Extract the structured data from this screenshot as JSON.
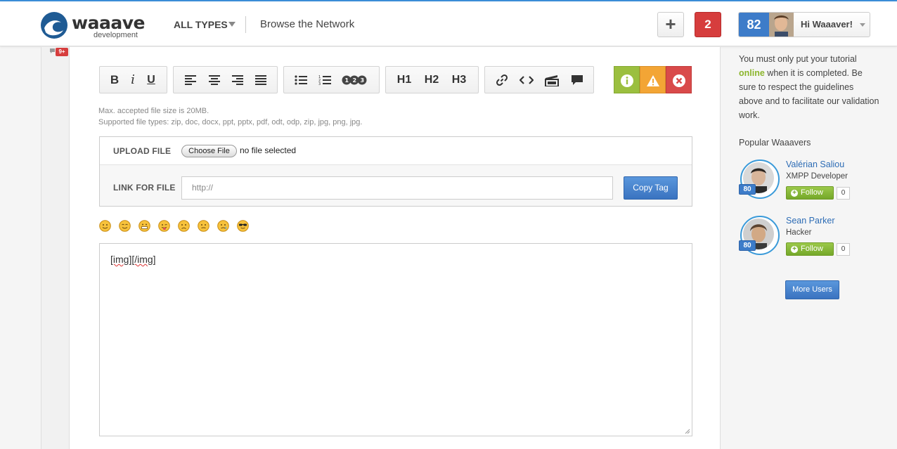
{
  "header": {
    "logo_word": "waaave",
    "logo_sub": "development",
    "types_label": "ALL TYPES",
    "browse_label": "Browse the Network",
    "add_label": "+",
    "notification_count": "2",
    "user_score": "82",
    "user_greeting": "Hi Waaaver!"
  },
  "left_badge": "9+",
  "toolbar": {
    "h1": "H1",
    "h2": "H2",
    "h3": "H3",
    "bold": "B",
    "italic": "i",
    "underline": "U"
  },
  "upload": {
    "max_size_note": "Max. accepted file size is 20MB.",
    "types_note": "Supported file types: zip, doc, docx, ppt, pptx, pdf, odt, odp, zip, jpg, png, jpg.",
    "upload_label": "UPLOAD FILE",
    "choose_label": "Choose File",
    "no_file": "no file selected",
    "link_label": "LINK FOR FILE",
    "link_placeholder": "http://",
    "copy_tag": "Copy Tag"
  },
  "editor": {
    "content_open": "[img]",
    "content_close": "[/img]"
  },
  "sidebar": {
    "notice_before": "You must only put your tutorial ",
    "notice_highlight": "online",
    "notice_after": " when it is completed. Be sure to respect the guidelines above and to facilitate our validation work.",
    "popular_title": "Popular Waaavers",
    "users": [
      {
        "name": "Valérian Saliou",
        "role": "XMPP Developer",
        "score": "80",
        "follow": "Follow",
        "followers": "0"
      },
      {
        "name": "Sean Parker",
        "role": "Hacker",
        "score": "80",
        "follow": "Follow",
        "followers": "0"
      }
    ],
    "more_users": "More Users"
  },
  "colors": {
    "accent_blue": "#3d7cc9",
    "danger_red": "#d63d3d",
    "success_green": "#8bb52c",
    "warning_orange": "#f3a535"
  }
}
